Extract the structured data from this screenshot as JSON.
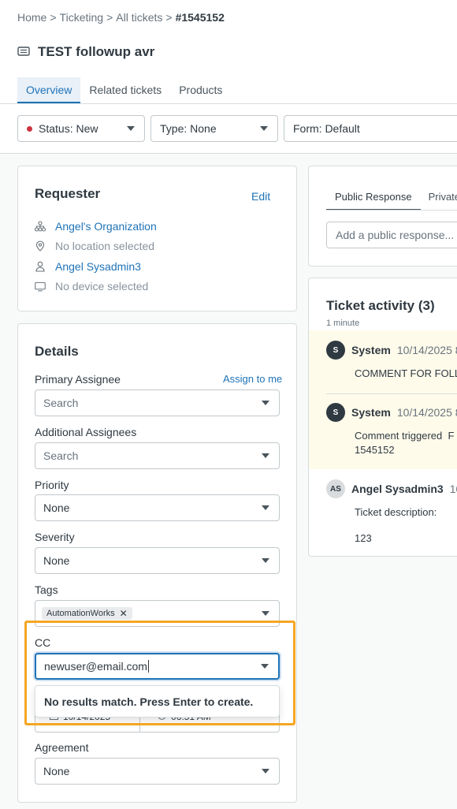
{
  "breadcrumb": {
    "home": "Home",
    "ticketing": "Ticketing",
    "all": "All tickets",
    "current": "#1545152",
    "sep": ">"
  },
  "ticket": {
    "title": "TEST followup avr"
  },
  "tabs": [
    {
      "label": "Overview"
    },
    {
      "label": "Related tickets"
    },
    {
      "label": "Products"
    }
  ],
  "filters": {
    "status": "Status: New",
    "type": "Type: None",
    "form": "Form: Default"
  },
  "requester": {
    "heading": "Requester",
    "edit": "Edit",
    "organization": "Angel's Organization",
    "location": "No location selected",
    "user": "Angel Sysadmin3",
    "device": "No device selected"
  },
  "details": {
    "heading": "Details",
    "primary_assignee_label": "Primary Assignee",
    "assign_to_me": "Assign to me",
    "primary_assignee_placeholder": "Search",
    "additional_assignees_label": "Additional Assignees",
    "additional_assignees_placeholder": "Search",
    "priority_label": "Priority",
    "priority_value": "None",
    "severity_label": "Severity",
    "severity_value": "None",
    "tags_label": "Tags",
    "tag1": "AutomationWorks",
    "cc_label": "CC",
    "cc_value": "newuser@email.com",
    "cc_dropdown_message": "No results match. Press Enter to create.",
    "date_value": "10/14/2025",
    "time_value": "06:51 AM",
    "agreement_label": "Agreement",
    "agreement_value": "None"
  },
  "response": {
    "tab_public": "Public Response",
    "tab_private": "Private",
    "placeholder": "Add a public response..."
  },
  "activity": {
    "heading": "Ticket activity (3)",
    "time_ago": "1 minute",
    "items": [
      {
        "initials": "S",
        "author": "System",
        "date": "10/14/2025 8:",
        "body": "COMMENT FOR FOLL"
      },
      {
        "initials": "S",
        "author": "System",
        "date": "10/14/2025 8:",
        "body": "Comment triggered  F",
        "body2": "1545152"
      },
      {
        "initials": "AS",
        "author": "Angel Sysadmin3",
        "date": "10/1",
        "body": "Ticket description:",
        "body2": "123"
      }
    ]
  },
  "colors": {
    "accent": "#1f73b7",
    "highlight": "#f5a623",
    "status_dot": "#cc3340",
    "activity_bg": "#fffbeb"
  }
}
